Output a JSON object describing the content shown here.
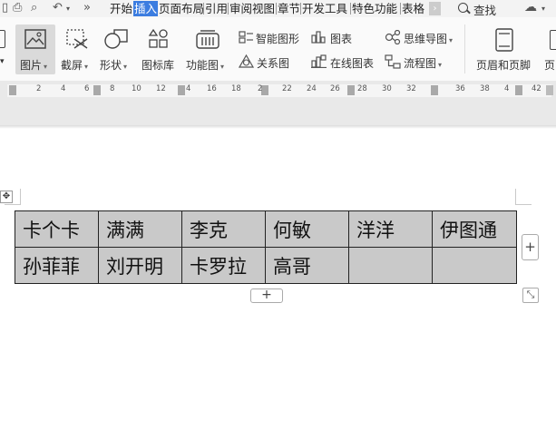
{
  "tabbar": {
    "overflow_label": "»",
    "tabs": [
      {
        "label": "开始"
      },
      {
        "label": "插入",
        "active": true
      },
      {
        "label": "页面布局"
      },
      {
        "label": "引用"
      },
      {
        "label": "审阅"
      },
      {
        "label": "视图"
      },
      {
        "label": "章节"
      },
      {
        "label": "开发工具"
      },
      {
        "label": "特色功能"
      },
      {
        "label": "表格"
      }
    ],
    "search_label": "查找",
    "active_color": "#3c7de0"
  },
  "ribbon": {
    "picture_label": "图片",
    "screenshot_label": "截屏",
    "shape_label": "形状",
    "icon_lib_label": "图标库",
    "function_chart_label": "功能图",
    "smartart_label": "智能图形",
    "chart_label": "图表",
    "mindmap_label": "思维导图",
    "relation_label": "关系图",
    "online_chart_label": "在线图表",
    "flowchart_label": "流程图",
    "header_footer_label": "页眉和页脚",
    "page_label_partial": "页"
  },
  "ruler": {
    "numbers": [
      "2",
      "4",
      "6",
      "8",
      "10",
      "12",
      "4",
      "16",
      "18",
      "2",
      "22",
      "24",
      "26",
      "28",
      "30",
      "32",
      "36",
      "38",
      "4",
      "42"
    ]
  },
  "table": {
    "rows": [
      [
        "卡个卡",
        "满满",
        "李克",
        "何敏",
        "洋洋",
        "伊图通"
      ],
      [
        "孙菲菲",
        "刘开明",
        "卡罗拉",
        "高哥",
        "",
        ""
      ]
    ],
    "cell_background": "#c9c9c9"
  },
  "controls": {
    "add_column": "+",
    "add_row": "+",
    "move_handle": "✥",
    "resize": "⤡"
  }
}
